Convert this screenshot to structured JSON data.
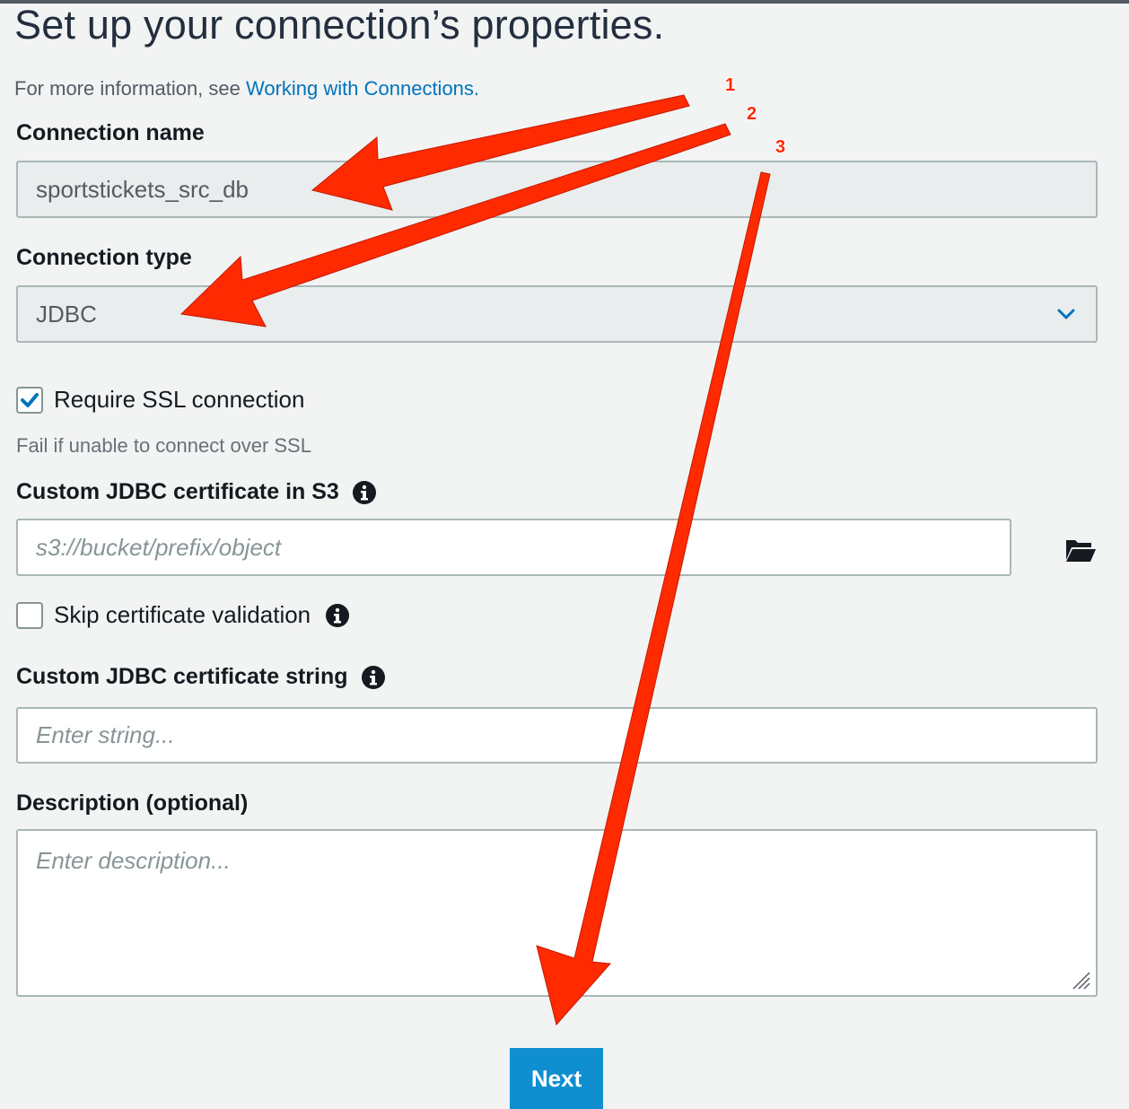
{
  "page": {
    "title": "Set up your connection’s properties.",
    "help_prefix": "For more information, see ",
    "help_link": "Working with Connections."
  },
  "form": {
    "name_label": "Connection name",
    "name_value": "sportstickets_src_db",
    "type_label": "Connection type",
    "type_value": "JDBC",
    "ssl_label": "Require SSL connection",
    "ssl_checked": true,
    "ssl_desc": "Fail if unable to connect over SSL",
    "cert_s3_label": "Custom JDBC certificate in S3",
    "cert_s3_placeholder": "s3://bucket/prefix/object",
    "skip_label": "Skip certificate validation",
    "skip_checked": false,
    "cert_string_label": "Custom JDBC certificate string",
    "cert_string_placeholder": "Enter string...",
    "description_label": "Description (optional)",
    "description_placeholder": "Enter description..."
  },
  "actions": {
    "next_label": "Next"
  },
  "annotations": {
    "numbers": [
      "1",
      "2",
      "3"
    ],
    "arrow_color": "#ff2a00"
  },
  "colors": {
    "link": "#0073bb",
    "primary_button": "#0f8fd0",
    "background": "#f2f3f3"
  }
}
